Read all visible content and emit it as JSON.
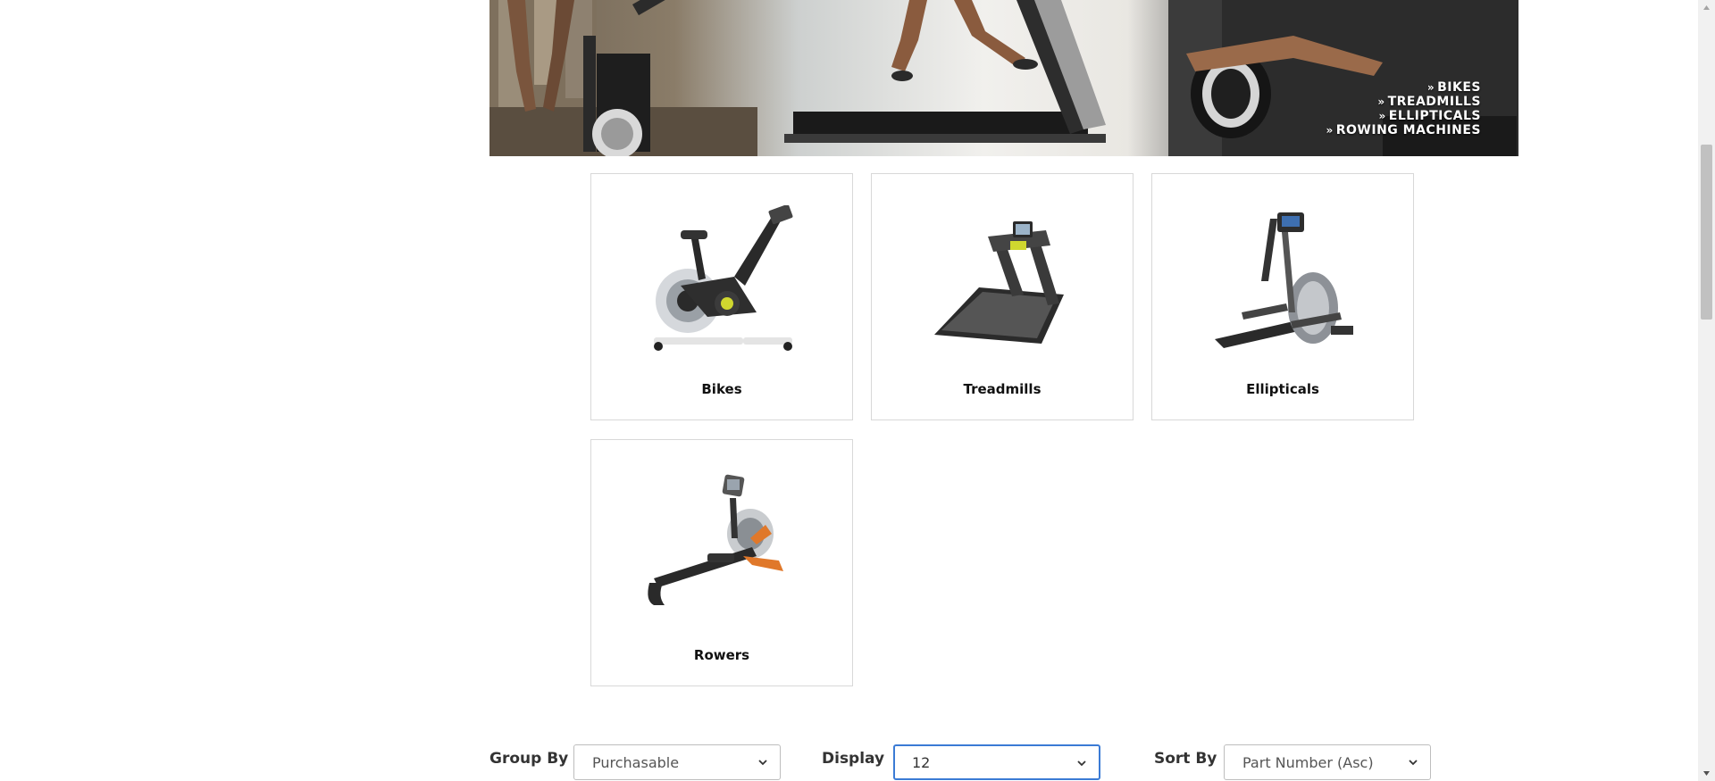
{
  "hero": {
    "links": [
      {
        "arrow": "»",
        "label": "BIKES"
      },
      {
        "arrow": "»",
        "label": "TREADMILLS"
      },
      {
        "arrow": "»",
        "label": "ELLIPTICALS"
      },
      {
        "arrow": "»",
        "label": "ROWING MACHINES"
      }
    ]
  },
  "categories": [
    {
      "label": "Bikes",
      "icon": "exercise-bike-icon"
    },
    {
      "label": "Treadmills",
      "icon": "treadmill-icon"
    },
    {
      "label": "Ellipticals",
      "icon": "elliptical-icon"
    },
    {
      "label": "Rowers",
      "icon": "rower-icon"
    }
  ],
  "filters": {
    "group_by": {
      "label": "Group By",
      "value": "Purchasable"
    },
    "display": {
      "label": "Display",
      "value": "12"
    },
    "sort_by": {
      "label": "Sort By",
      "value": "Part Number (Asc)"
    }
  },
  "colors": {
    "focus_border": "#3b7bd5",
    "card_border": "#d8d8d8"
  }
}
